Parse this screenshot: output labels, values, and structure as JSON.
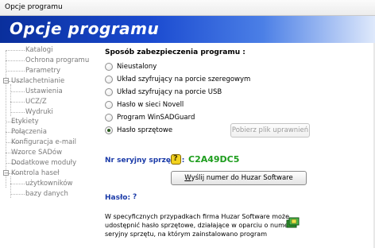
{
  "window": {
    "title": "Opcje programu"
  },
  "banner": {
    "title": "Opcje programu"
  },
  "sidebar": {
    "items": [
      {
        "label": "Katalogi"
      },
      {
        "label": "Ochrona programu"
      },
      {
        "label": "Parametry"
      },
      {
        "label": "Uszlachetnianie",
        "expander": "−"
      },
      {
        "label": "Ustawienia"
      },
      {
        "label": "UCZ/Z"
      },
      {
        "label": "Wydruki"
      },
      {
        "label": "Etykiety"
      },
      {
        "label": "Połączenia"
      },
      {
        "label": "Konfiguracja e-mail"
      },
      {
        "label": "Wzorce SADów"
      },
      {
        "label": "Dodatkowe moduły"
      },
      {
        "label": "Kontrola haseł",
        "expander": "−"
      },
      {
        "label": "użytkowników"
      },
      {
        "label": "bazy danych"
      }
    ]
  },
  "security": {
    "heading": "Sposób zabezpieczenia programu :",
    "options": [
      {
        "label": "Nieustalony",
        "checked": false
      },
      {
        "label": "Układ szyfrujący na porcie szeregowym",
        "checked": false
      },
      {
        "label": "Układ szyfrujący na porcie USB",
        "checked": false
      },
      {
        "label": "Hasło w sieci Novell",
        "checked": false
      },
      {
        "label": "Program WinSADGuard",
        "checked": false
      },
      {
        "label": "Hasło sprzętowe",
        "checked": true
      }
    ],
    "download_button": "Pobierz plik uprawnień"
  },
  "hardware": {
    "serial_label": "Nr seryjny sprzętu :",
    "serial_value": "C2A49DC5",
    "send_button": "Wyślij numer do Huzar Software",
    "password_label": "Hasło:",
    "password_value": "?"
  },
  "info": {
    "lines": [
      "W specyficznych przypadkach firma Huzar Software może",
      "udostępnić hasło sprzętowe, działające w oparciu o numer",
      "seryjny sprzętu, na którym zainstalowano program"
    ]
  },
  "colors": {
    "banner_dark": "#0a2f9c",
    "label_blue": "#1a3aa8",
    "serial_green": "#1d9d1d"
  }
}
